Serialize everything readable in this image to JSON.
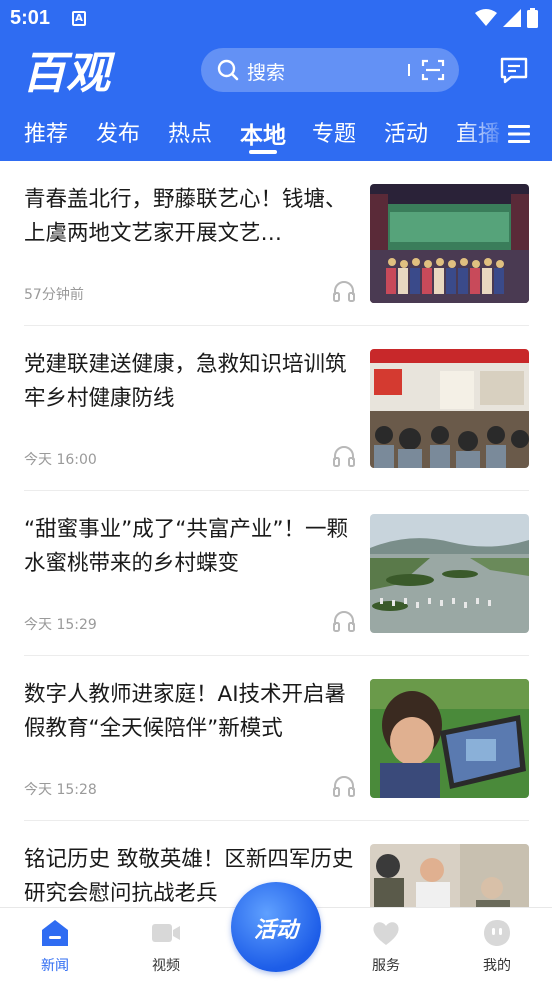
{
  "status_bar": {
    "time": "5:01",
    "notif_letter": "A"
  },
  "header": {
    "logo_text": "百观",
    "search_placeholder": "搜索",
    "tabs": [
      "推荐",
      "发布",
      "热点",
      "本地",
      "专题",
      "活动",
      "直播"
    ],
    "active_tab": "本地"
  },
  "news": [
    {
      "title": "青春盖北行，野藤联艺心！钱塘、上虞两地文艺家开展文艺…",
      "time": "57分钟前"
    },
    {
      "title": "党建联建送健康，急救知识培训筑牢乡村健康防线",
      "time": "今天 16:00"
    },
    {
      "title": "“甜蜜事业”成了“共富产业”！一颗水蜜桃带来的乡村蝶变",
      "time": "今天 15:29"
    },
    {
      "title": "数字人教师进家庭！AI技术开启暑假教育“全天候陪伴”新模式",
      "time": "今天 15:28"
    },
    {
      "title": "铭记历史 致敬英雄！区新四军历史研究会慰问抗战老兵",
      "time": ""
    }
  ],
  "bottom_nav": {
    "items": [
      "新闻",
      "视频",
      "服务",
      "我的"
    ],
    "center_label": "活动",
    "active": "新闻"
  },
  "colors": {
    "brand": "#2f6cf2",
    "text": "#1a1a1a",
    "meta": "#9a9a9a"
  }
}
